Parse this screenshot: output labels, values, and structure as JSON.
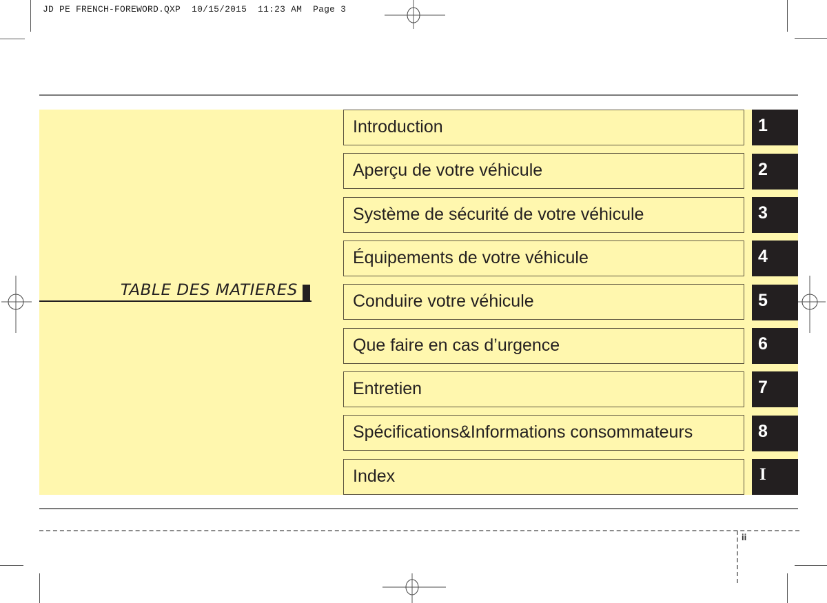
{
  "slug": {
    "filename": "JD PE FRENCH-FOREWORD.QXP",
    "date": "10/15/2015",
    "time": "11:23 AM",
    "page": "Page 3"
  },
  "title": "TABLE DES MATIERES",
  "toc": [
    {
      "label": "Introduction",
      "number": "1"
    },
    {
      "label": "Aperçu de votre véhicule",
      "number": "2"
    },
    {
      "label": "Système de sécurité de votre véhicule",
      "number": "3"
    },
    {
      "label": "Équipements de votre véhicule",
      "number": "4"
    },
    {
      "label": "Conduire votre véhicule",
      "number": "5"
    },
    {
      "label": "Que faire en cas d’urgence",
      "number": "6"
    },
    {
      "label": "Entretien",
      "number": "7"
    },
    {
      "label": "Spécifications&Informations consommateurs",
      "number": "8"
    },
    {
      "label": "Index",
      "number": "I"
    }
  ],
  "folio": "ii",
  "colors": {
    "panel": "#FFF7AE",
    "tab": "#231F20",
    "tab_text": "#FFFFFF"
  }
}
